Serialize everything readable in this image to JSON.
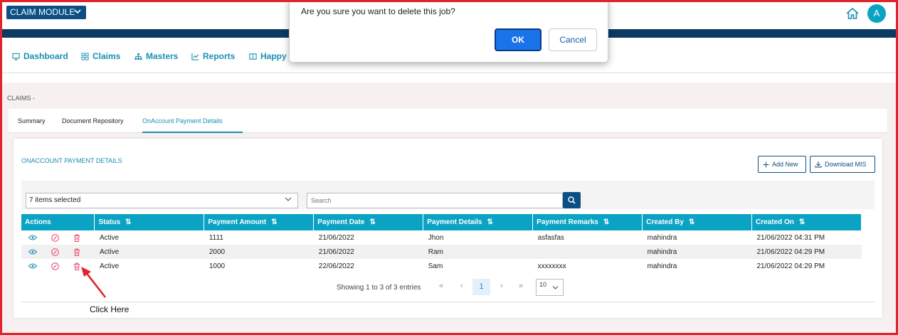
{
  "app": {
    "module_label": "CLAIM MODULE",
    "avatar_letter": "A"
  },
  "nav": {
    "items": [
      {
        "label": "Dashboard",
        "icon": "monitor-icon"
      },
      {
        "label": "Claims",
        "icon": "grid-icon"
      },
      {
        "label": "Masters",
        "icon": "sitemap-icon"
      },
      {
        "label": "Reports",
        "icon": "chart-icon"
      },
      {
        "label": "Happy t",
        "icon": "book-icon"
      }
    ]
  },
  "breadcrumb": "CLAIMS -",
  "tabs": [
    {
      "label": "Summary"
    },
    {
      "label": "Document Repository"
    },
    {
      "label": "OnAccount Payment Details"
    }
  ],
  "panel": {
    "title": "ONACCOUNT PAYMENT DETAILS",
    "add_new_label": "Add New",
    "download_label": "Download MIS",
    "filter_selected": "7 items selected",
    "search_placeholder": "Search"
  },
  "table": {
    "headers": [
      "Actions",
      "Status",
      "Payment Amount",
      "Payment Date",
      "Payment Details",
      "Payment Remarks",
      "Created By",
      "Created On"
    ],
    "rows": [
      {
        "status": "Active",
        "amount": "1111",
        "date": "21/06/2022",
        "details": "Jhon",
        "remarks": "asfasfas",
        "created_by": "mahindra",
        "created_on": "21/06/2022 04:31 PM"
      },
      {
        "status": "Active",
        "amount": "2000",
        "date": "21/06/2022",
        "details": "Ram",
        "remarks": "",
        "created_by": "mahindra",
        "created_on": "21/06/2022 04:29 PM"
      },
      {
        "status": "Active",
        "amount": "1000",
        "date": "22/06/2022",
        "details": "Sam",
        "remarks": "xxxxxxxx",
        "created_by": "mahindra",
        "created_on": "21/06/2022 04:29 PM"
      }
    ]
  },
  "pagination": {
    "info": "Showing 1 to 3 of 3 entries",
    "current_page": "1",
    "first": "«",
    "prev": "‹",
    "next": "›",
    "last": "»",
    "page_size": "10"
  },
  "annotation": {
    "text": "Click Here"
  },
  "dialog": {
    "message": "Are you sure you want to delete this job?",
    "ok_label": "OK",
    "cancel_label": "Cancel"
  },
  "colors": {
    "brand": "#0b4f86",
    "header_bar": "#0b3a63",
    "table_header": "#0aa3c4",
    "accent": "#1a8fb3",
    "annotation": "#e0242b",
    "ok_button": "#1a73e8"
  }
}
